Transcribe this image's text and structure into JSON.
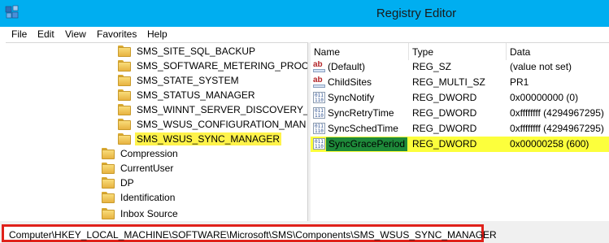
{
  "window": {
    "title": "Registry Editor"
  },
  "menu": [
    "File",
    "Edit",
    "View",
    "Favorites",
    "Help"
  ],
  "tree": {
    "children": [
      "SMS_SITE_SQL_BACKUP",
      "SMS_SOFTWARE_METERING_PROCE",
      "SMS_STATE_SYSTEM",
      "SMS_STATUS_MANAGER",
      "SMS_WINNT_SERVER_DISCOVERY_A",
      "SMS_WSUS_CONFIGURATION_MAN",
      "SMS_WSUS_SYNC_MANAGER"
    ],
    "selected_child": "SMS_WSUS_SYNC_MANAGER",
    "siblings": [
      "Compression",
      "CurrentUser",
      "DP",
      "Identification",
      "Inbox Source"
    ]
  },
  "values": {
    "headers": {
      "name": "Name",
      "type": "Type",
      "data": "Data"
    },
    "rows": [
      {
        "icon": "string-value-icon",
        "name": "(Default)",
        "type": "REG_SZ",
        "data": "(value not set)"
      },
      {
        "icon": "string-value-icon",
        "name": "ChildSites",
        "type": "REG_MULTI_SZ",
        "data": "PR1"
      },
      {
        "icon": "binary-value-icon",
        "name": "SyncNotify",
        "type": "REG_DWORD",
        "data": "0x00000000 (0)"
      },
      {
        "icon": "binary-value-icon",
        "name": "SyncRetryTime",
        "type": "REG_DWORD",
        "data": "0xffffffff (4294967295)"
      },
      {
        "icon": "binary-value-icon",
        "name": "SyncSchedTime",
        "type": "REG_DWORD",
        "data": "0xffffffff (4294967295)"
      },
      {
        "icon": "binary-value-icon",
        "name": "SyncGracePeriod",
        "type": "REG_DWORD",
        "data": "0x00000258 (600)"
      }
    ]
  },
  "status": {
    "path": "Computer\\HKEY_LOCAL_MACHINE\\SOFTWARE\\Microsoft\\SMS\\Components\\SMS_WSUS_SYNC_MANAGER"
  },
  "colors": {
    "titlebar": "#00aef0",
    "highlight": "#fcff3c",
    "selection": "#1e8a3a",
    "callout": "#e0211a"
  }
}
